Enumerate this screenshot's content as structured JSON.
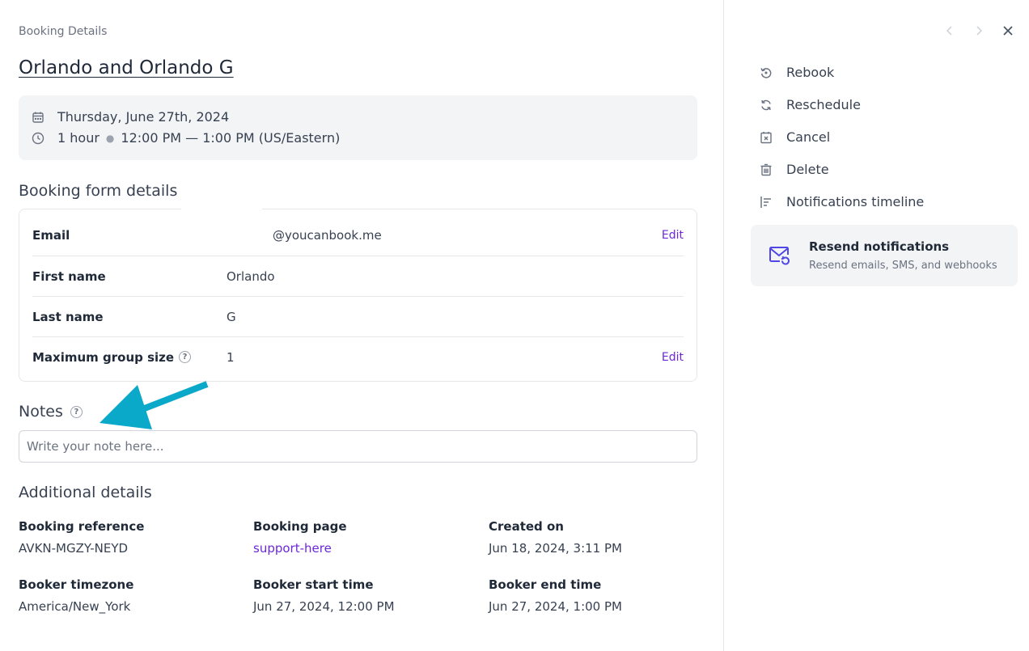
{
  "breadcrumb": "Booking Details",
  "title": "Orlando and Orlando G",
  "when": {
    "date": "Thursday, June 27th, 2024",
    "duration": "1 hour",
    "time": "12:00 PM — 1:00 PM (US/Eastern)"
  },
  "form": {
    "heading": "Booking form details",
    "rows": [
      {
        "label": "Email",
        "value": "@youcanbook.me",
        "edit": "Edit"
      },
      {
        "label": "First name",
        "value": "Orlando"
      },
      {
        "label": "Last name",
        "value": "G"
      },
      {
        "label": "Maximum group size",
        "value": "1",
        "edit": "Edit",
        "help_icon": "question-circle-icon"
      }
    ]
  },
  "notes": {
    "heading": "Notes",
    "placeholder": "Write your note here..."
  },
  "additional": {
    "heading": "Additional details",
    "items": [
      {
        "label": "Booking reference",
        "value": "AVKN-MGZY-NEYD"
      },
      {
        "label": "Booking page",
        "value": "support-here"
      },
      {
        "label": "Created on",
        "value": "Jun 18, 2024, 3:11 PM"
      },
      {
        "label": "Booker timezone",
        "value": "America/New_York"
      },
      {
        "label": "Booker start time",
        "value": "Jun 27, 2024, 12:00 PM"
      },
      {
        "label": "Booker end time",
        "value": "Jun 27, 2024, 1:00 PM"
      }
    ]
  },
  "side": {
    "actions": [
      {
        "label": "Rebook",
        "icon": "rebook-icon"
      },
      {
        "label": "Reschedule",
        "icon": "refresh-icon"
      },
      {
        "label": "Cancel",
        "icon": "calendar-x-icon"
      },
      {
        "label": "Delete",
        "icon": "trash-icon"
      },
      {
        "label": "Notifications timeline",
        "icon": "timeline-icon"
      }
    ],
    "resend": {
      "title": "Resend notifications",
      "subtitle": "Resend emails, SMS, and webhooks",
      "icon": "mail-resend-icon"
    }
  },
  "colors": {
    "accent": "#6d28d9",
    "annotation_arrow": "#0aa9c9",
    "panel_bg": "#f3f4f6"
  }
}
